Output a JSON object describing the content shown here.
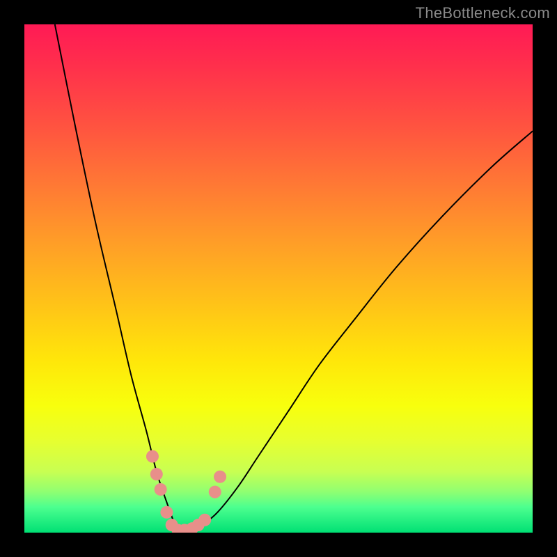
{
  "watermark": "TheBottleneck.com",
  "colors": {
    "background": "#000000",
    "gradient_top": "#ff1a55",
    "gradient_bottom": "#00e074",
    "curve_stroke": "#000000",
    "marker_fill": "#e88f8a"
  },
  "chart_data": {
    "type": "line",
    "title": "",
    "xlabel": "",
    "ylabel": "",
    "xlim": [
      0,
      100
    ],
    "ylim": [
      0,
      100
    ],
    "series": [
      {
        "name": "curve",
        "x": [
          6,
          10,
          14,
          18,
          21,
          24,
          26,
          28,
          29.5,
          31,
          33,
          35,
          38,
          42,
          46,
          52,
          58,
          65,
          73,
          82,
          92,
          100
        ],
        "y": [
          100,
          80,
          61,
          44,
          31,
          20,
          12,
          6,
          2,
          0.3,
          0.3,
          1.5,
          4,
          9,
          15,
          24,
          33,
          42,
          52,
          62,
          72,
          79
        ]
      }
    ],
    "markers": [
      {
        "x": 25.2,
        "y": 15.0
      },
      {
        "x": 26.0,
        "y": 11.5
      },
      {
        "x": 26.8,
        "y": 8.5
      },
      {
        "x": 28.0,
        "y": 4.0
      },
      {
        "x": 29.0,
        "y": 1.5
      },
      {
        "x": 30.2,
        "y": 0.5
      },
      {
        "x": 31.5,
        "y": 0.5
      },
      {
        "x": 33.0,
        "y": 0.8
      },
      {
        "x": 34.2,
        "y": 1.5
      },
      {
        "x": 35.5,
        "y": 2.5
      },
      {
        "x": 37.5,
        "y": 8.0
      },
      {
        "x": 38.5,
        "y": 11.0
      }
    ]
  }
}
